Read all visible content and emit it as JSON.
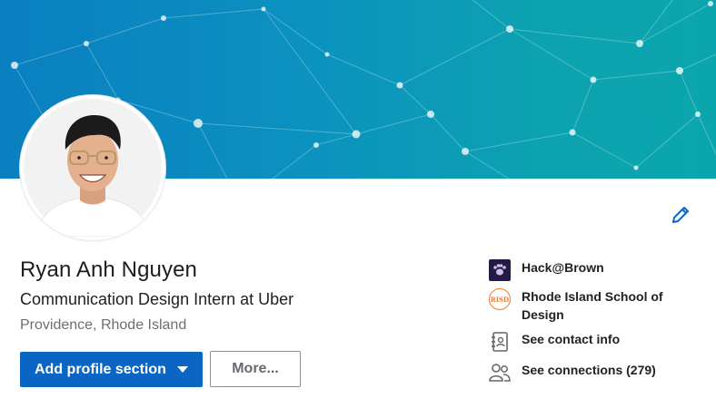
{
  "profile": {
    "name": "Ryan Anh Nguyen",
    "headline": "Communication Design Intern at Uber",
    "location": "Providence, Rhode Island"
  },
  "actions": {
    "add_section_label": "Add profile section",
    "more_label": "More..."
  },
  "sidebar": {
    "items": [
      {
        "label": "Hack@Brown",
        "icon": "hack-brown-logo"
      },
      {
        "label": "Rhode Island School of Design",
        "icon": "risd-logo",
        "logo_text": "RISD"
      },
      {
        "label": "See contact info",
        "icon": "contact-card-icon"
      },
      {
        "label": "See connections (279)",
        "icon": "people-icon"
      }
    ]
  },
  "colors": {
    "primary": "#0a66c2",
    "banner_start": "#0a7fc0",
    "banner_end": "#0ba6ad",
    "edit_icon": "#0a66c2"
  }
}
